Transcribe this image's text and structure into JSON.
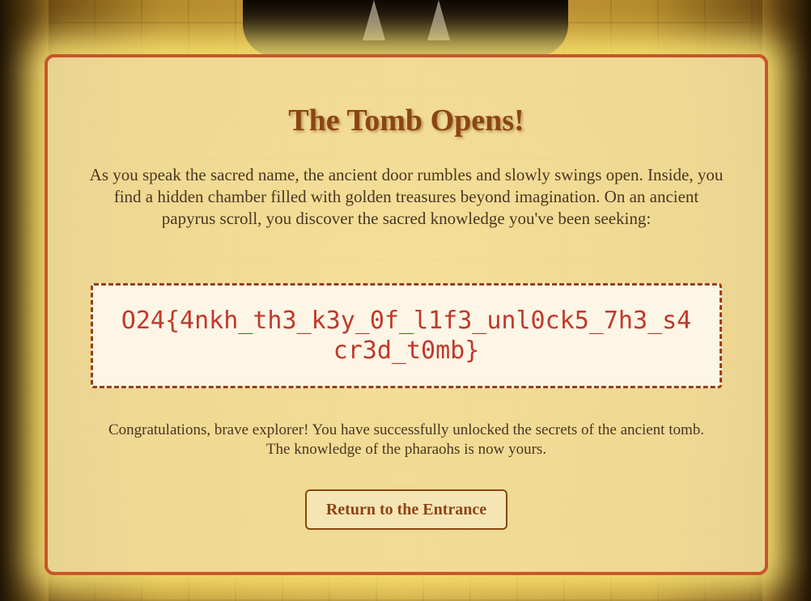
{
  "modal": {
    "title": "The Tomb Opens!",
    "intro": "As you speak the sacred name, the ancient door rumbles and slowly swings open. Inside, you find a hidden chamber filled with golden treasures beyond imagination. On an ancient papyrus scroll, you discover the sacred knowledge you've been seeking:",
    "flag": "O24{4nkh_th3_k3y_0f_l1f3_unl0ck5_7h3_s4cr3d_t0mb}",
    "congrats": "Congratulations, brave explorer! You have successfully unlocked the secrets of the ancient tomb. The knowledge of the pharaohs is now yours.",
    "return_label": "Return to the Entrance"
  },
  "colors": {
    "accent_border": "#c8552b",
    "title": "#8b4513",
    "flag_text": "#c0392b",
    "card_background": "#f6e29e"
  }
}
